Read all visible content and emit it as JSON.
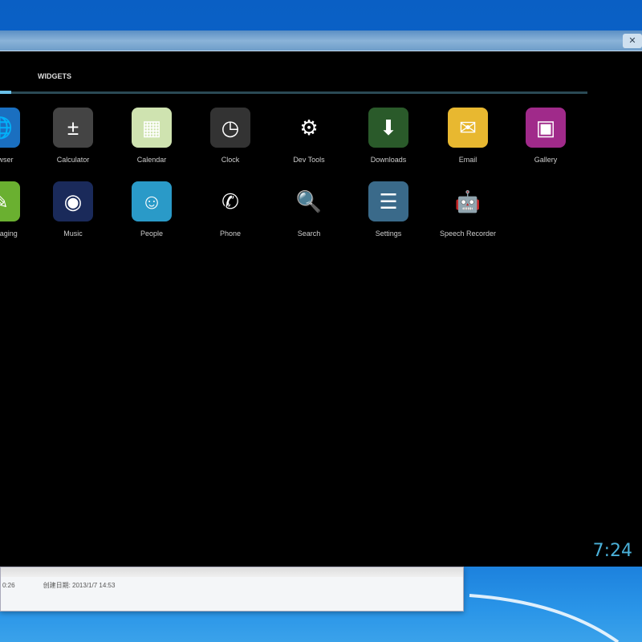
{
  "tabs": {
    "widgets": "WIDGETS"
  },
  "apps": [
    {
      "label": "Browser",
      "icon": "globe-icon",
      "glyph": "🌐",
      "bg": "#1a6fc0"
    },
    {
      "label": "Calculator",
      "icon": "calculator-icon",
      "glyph": "±",
      "bg": "#444"
    },
    {
      "label": "Calendar",
      "icon": "calendar-icon",
      "glyph": "▦",
      "bg": "#cfe3b0"
    },
    {
      "label": "Clock",
      "icon": "clock-icon",
      "glyph": "◷",
      "bg": "#333"
    },
    {
      "label": "Dev Tools",
      "icon": "gear-icon",
      "glyph": "⚙",
      "bg": "#000"
    },
    {
      "label": "Downloads",
      "icon": "download-icon",
      "glyph": "⬇",
      "bg": "#2a5a2a"
    },
    {
      "label": "Email",
      "icon": "email-icon",
      "glyph": "✉",
      "bg": "#e8b830"
    },
    {
      "label": "Gallery",
      "icon": "gallery-icon",
      "glyph": "▣",
      "bg": "#a02a8a"
    },
    {
      "label": "Messaging",
      "icon": "messaging-icon",
      "glyph": "✎",
      "bg": "#6ab030"
    },
    {
      "label": "Music",
      "icon": "music-icon",
      "glyph": "◉",
      "bg": "#1a2a5a"
    },
    {
      "label": "People",
      "icon": "people-icon",
      "glyph": "☺",
      "bg": "#2a9ac8"
    },
    {
      "label": "Phone",
      "icon": "phone-icon",
      "glyph": "✆",
      "bg": "#000"
    },
    {
      "label": "Search",
      "icon": "search-icon",
      "glyph": "🔍",
      "bg": "#000"
    },
    {
      "label": "Settings",
      "icon": "settings-icon",
      "glyph": "☰",
      "bg": "#3a6a8a"
    },
    {
      "label": "Speech Recorder",
      "icon": "android-icon",
      "glyph": "🤖",
      "bg": "#000"
    }
  ],
  "status": {
    "clock": "7:24"
  },
  "explorer": {
    "date_label": "创建日期: 2013/1/7 14:53",
    "left_value": "0:26"
  }
}
